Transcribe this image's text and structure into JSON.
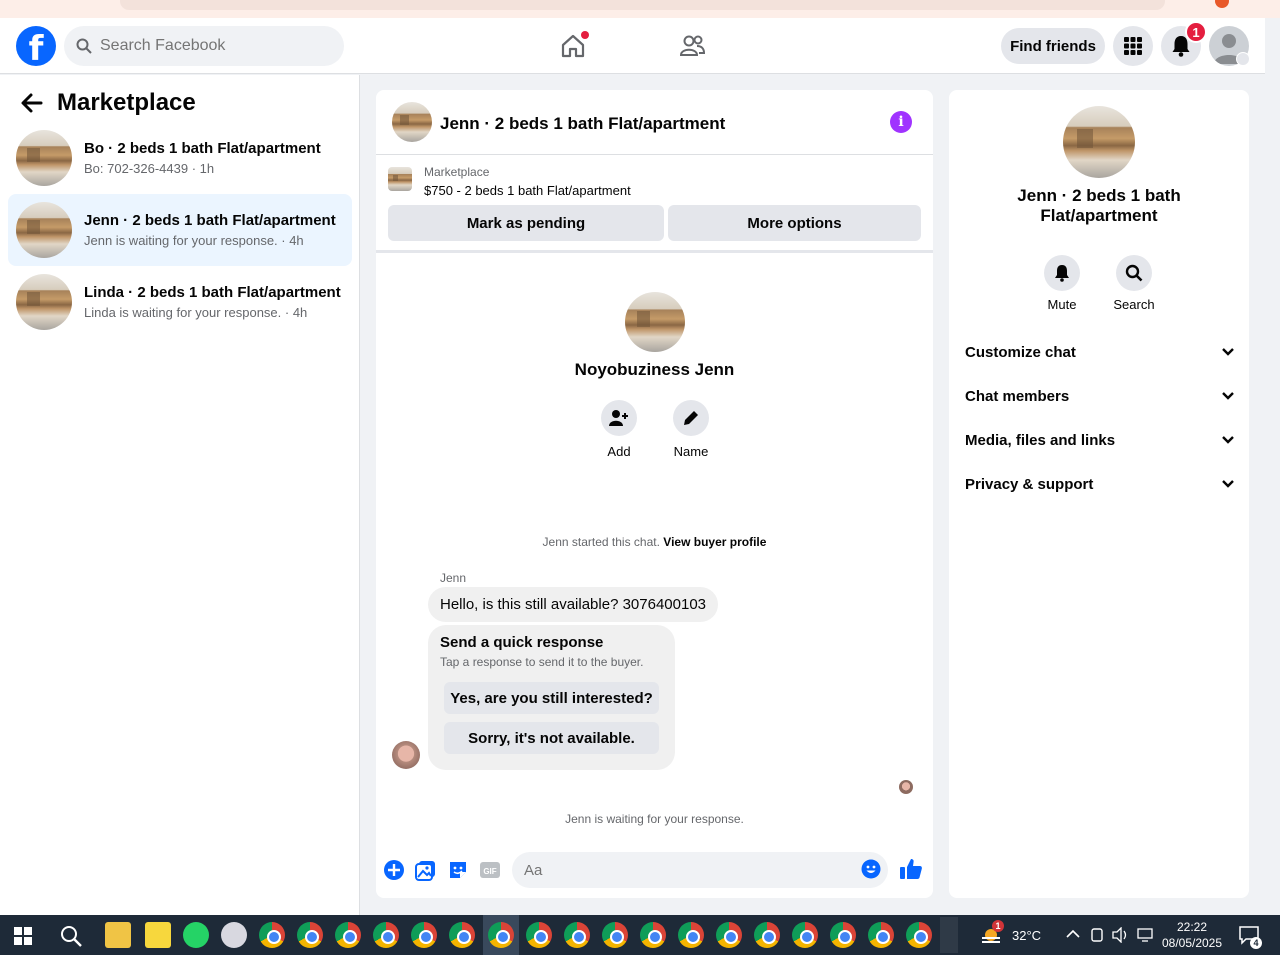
{
  "topbar": {
    "search_placeholder": "Search Facebook",
    "find_friends_label": "Find friends",
    "notification_count": "1"
  },
  "marketplace": {
    "title": "Marketplace",
    "conversations": [
      {
        "title": "Bo · 2 beds 1 bath Flat/apartment",
        "subtitle": "Bo: 702-326-4439 · 1h",
        "active": false
      },
      {
        "title": "Jenn · 2 beds 1 bath Flat/apartment",
        "subtitle": "Jenn is waiting for your response. · 4h",
        "active": true
      },
      {
        "title": "Linda · 2 beds 1 bath Flat/apartment",
        "subtitle": "Linda is waiting for your response. · 4h",
        "active": false
      }
    ]
  },
  "chat": {
    "title": "Jenn · 2 beds 1 bath Flat/apartment",
    "listing_source": "Marketplace",
    "listing_price": "$750 - 2 beds 1 bath Flat/apartment",
    "mark_pending_label": "Mark as pending",
    "more_options_label": "More options",
    "profile_name": "Noyobuziness Jenn",
    "add_label": "Add",
    "name_label": "Name",
    "started_text": "Jenn started this chat.",
    "view_profile_link": "View buyer profile",
    "sender_name": "Jenn",
    "message": "Hello, is this still available? 3076400103",
    "quick_title": "Send a quick response",
    "quick_subtitle": "Tap a response to send it to the buyer.",
    "quick_option_1": "Yes, are you still interested?",
    "quick_option_2": "Sorry, it's not available.",
    "waiting_text": "Jenn is waiting for your response.",
    "input_placeholder": "Aa"
  },
  "details": {
    "title": "Jenn · 2 beds 1 bath Flat/apartment",
    "mute_label": "Mute",
    "search_label": "Search",
    "rows": [
      "Customize chat",
      "Chat members",
      "Media, files and links",
      "Privacy & support"
    ]
  },
  "taskbar": {
    "temperature": "32°C",
    "weather_badge": "1",
    "time": "22:22",
    "date": "08/05/2025",
    "notification_count": "4"
  },
  "colors": {
    "brand_blue": "#0866ff",
    "active_row": "#ebf5ff",
    "badge_red": "#e41e3f",
    "info_purple": "#a033ff"
  }
}
